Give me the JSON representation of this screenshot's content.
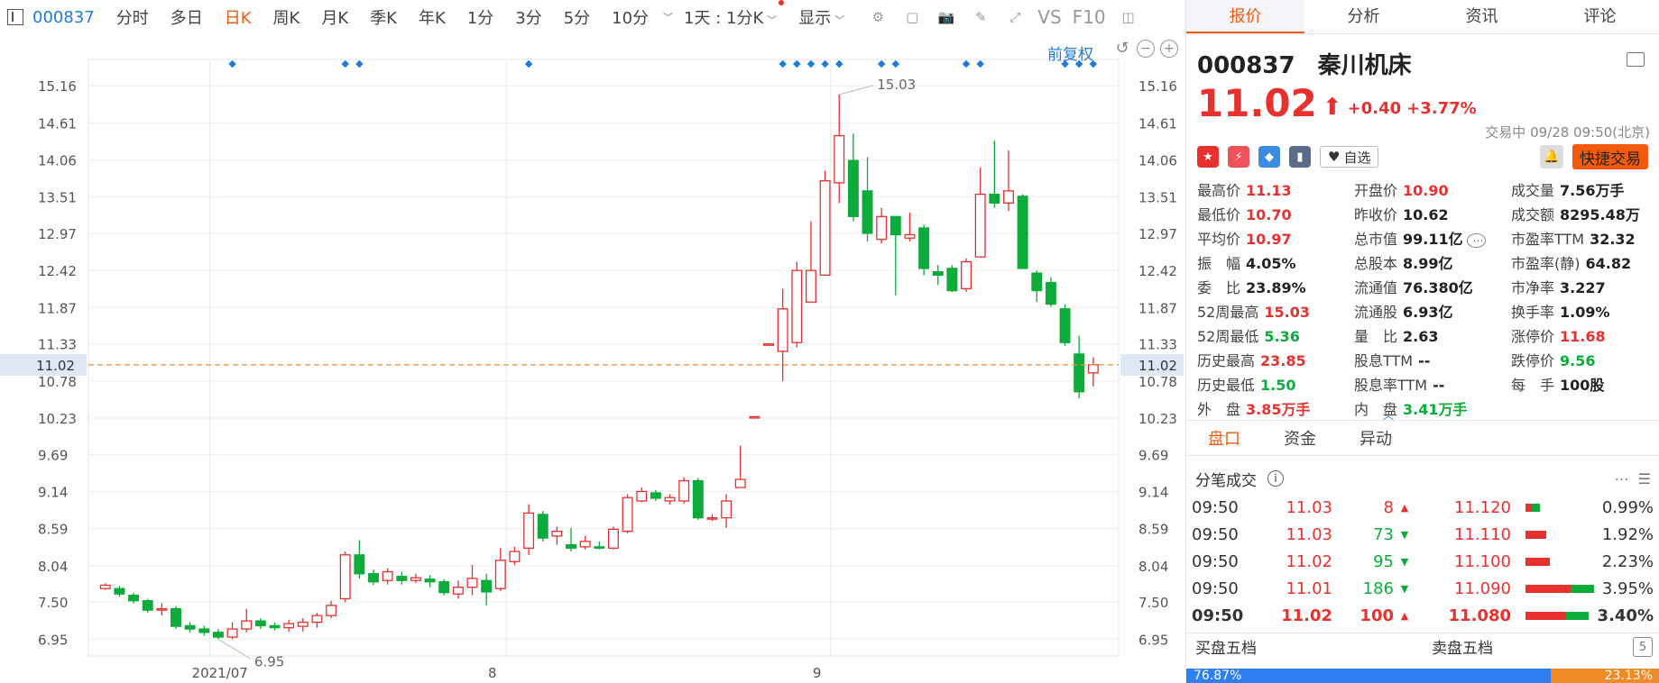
{
  "toolbar": {
    "code": "000837",
    "items": [
      "分时",
      "多日",
      "日K",
      "周K",
      "月K",
      "季K",
      "年K",
      "1分",
      "3分",
      "5分",
      "10分"
    ],
    "active": "日K",
    "period_select": "1天 : 1分K",
    "display": "显示",
    "f10": "F10",
    "vs": "VS"
  },
  "chart_controls": {
    "adjust": "前复权"
  },
  "chart_data": {
    "type": "candlestick",
    "x_labels": [
      "2021/07",
      "8",
      "9"
    ],
    "y_ticks": [
      15.16,
      14.61,
      14.06,
      13.51,
      12.97,
      12.42,
      11.87,
      11.33,
      10.78,
      10.23,
      9.69,
      9.14,
      8.59,
      8.04,
      7.5,
      6.95
    ],
    "ylim": [
      6.7,
      15.55
    ],
    "current_price": "11.02",
    "annotations": {
      "high": "15.03",
      "low": "6.95"
    },
    "candles": [
      [
        7.7,
        7.75,
        7.68,
        7.78
      ],
      [
        7.7,
        7.62,
        7.58,
        7.74
      ],
      [
        7.6,
        7.52,
        7.48,
        7.64
      ],
      [
        7.52,
        7.38,
        7.34,
        7.55
      ],
      [
        7.38,
        7.4,
        7.3,
        7.48
      ],
      [
        7.4,
        7.14,
        7.1,
        7.44
      ],
      [
        7.15,
        7.1,
        7.05,
        7.2
      ],
      [
        7.1,
        7.05,
        7.0,
        7.15
      ],
      [
        7.05,
        6.98,
        6.95,
        7.1
      ],
      [
        6.98,
        7.1,
        6.95,
        7.2
      ],
      [
        7.1,
        7.22,
        7.05,
        7.4
      ],
      [
        7.22,
        7.15,
        7.1,
        7.26
      ],
      [
        7.15,
        7.12,
        7.08,
        7.2
      ],
      [
        7.12,
        7.18,
        7.06,
        7.24
      ],
      [
        7.14,
        7.2,
        7.06,
        7.26
      ],
      [
        7.2,
        7.3,
        7.12,
        7.34
      ],
      [
        7.3,
        7.45,
        7.26,
        7.52
      ],
      [
        7.55,
        8.2,
        7.5,
        8.25
      ],
      [
        8.2,
        7.92,
        7.85,
        8.42
      ],
      [
        7.92,
        7.8,
        7.75,
        7.98
      ],
      [
        7.82,
        7.95,
        7.76,
        8.0
      ],
      [
        7.88,
        7.82,
        7.76,
        7.95
      ],
      [
        7.82,
        7.86,
        7.78,
        7.92
      ],
      [
        7.84,
        7.8,
        7.72,
        7.9
      ],
      [
        7.8,
        7.64,
        7.6,
        7.84
      ],
      [
        7.62,
        7.72,
        7.55,
        7.82
      ],
      [
        7.72,
        7.85,
        7.6,
        8.05
      ],
      [
        7.82,
        7.65,
        7.45,
        7.92
      ],
      [
        7.7,
        8.12,
        7.66,
        8.3
      ],
      [
        8.1,
        8.25,
        8.05,
        8.32
      ],
      [
        8.3,
        8.82,
        8.2,
        8.95
      ],
      [
        8.8,
        8.45,
        8.4,
        8.85
      ],
      [
        8.48,
        8.55,
        8.35,
        8.62
      ],
      [
        8.35,
        8.3,
        8.25,
        8.6
      ],
      [
        8.32,
        8.4,
        8.28,
        8.48
      ],
      [
        8.32,
        8.3,
        8.28,
        8.4
      ],
      [
        8.3,
        8.58,
        8.28,
        8.62
      ],
      [
        8.55,
        9.05,
        8.52,
        9.1
      ],
      [
        9.0,
        9.14,
        8.98,
        9.2
      ],
      [
        9.12,
        9.04,
        9.0,
        9.16
      ],
      [
        9.0,
        9.05,
        8.95,
        9.1
      ],
      [
        9.0,
        9.3,
        8.96,
        9.35
      ],
      [
        9.3,
        8.75,
        8.72,
        9.34
      ],
      [
        8.75,
        8.75,
        8.7,
        8.8
      ],
      [
        8.75,
        9.0,
        8.6,
        9.1
      ],
      [
        9.2,
        9.32,
        9.2,
        9.82
      ],
      [
        10.25,
        10.25,
        10.25,
        10.25
      ],
      [
        11.33,
        11.33,
        11.33,
        11.33
      ],
      [
        11.22,
        11.85,
        10.78,
        12.15
      ],
      [
        11.35,
        12.42,
        11.28,
        12.55
      ],
      [
        11.95,
        12.42,
        11.95,
        13.15
      ],
      [
        12.35,
        13.75,
        12.35,
        13.9
      ],
      [
        13.72,
        14.42,
        13.42,
        15.03
      ],
      [
        14.05,
        13.22,
        13.15,
        14.45
      ],
      [
        13.6,
        12.97,
        12.85,
        14.1
      ],
      [
        12.88,
        13.22,
        12.82,
        13.35
      ],
      [
        13.22,
        12.95,
        12.05,
        13.22
      ],
      [
        12.9,
        12.95,
        12.85,
        13.28
      ],
      [
        13.05,
        12.45,
        12.35,
        13.1
      ],
      [
        12.4,
        12.35,
        12.2,
        12.5
      ],
      [
        12.45,
        12.12,
        12.1,
        12.5
      ],
      [
        12.15,
        12.55,
        12.1,
        12.6
      ],
      [
        12.62,
        13.55,
        12.62,
        13.95
      ],
      [
        13.55,
        13.42,
        13.35,
        14.35
      ],
      [
        13.42,
        13.6,
        13.3,
        14.2
      ],
      [
        13.52,
        12.45,
        12.45,
        13.55
      ],
      [
        12.38,
        12.12,
        11.95,
        12.42
      ],
      [
        12.24,
        11.92,
        11.88,
        12.32
      ],
      [
        11.85,
        11.35,
        11.3,
        11.92
      ],
      [
        11.18,
        10.62,
        10.52,
        11.45
      ],
      [
        10.9,
        11.02,
        10.7,
        11.13
      ]
    ]
  },
  "panel": {
    "tabs": [
      "报价",
      "分析",
      "资讯",
      "评论"
    ],
    "active_tab": "报价",
    "code": "000837",
    "name": "秦川机床",
    "price": "11.02",
    "change": "+0.40",
    "change_pct": "+3.77%",
    "trade_time": "交易中 09/28 09:50(北京)",
    "watch": "自选",
    "quick_trade": "快捷交易",
    "quotes": [
      {
        "label": "最高价",
        "value": "11.13",
        "color": "red"
      },
      {
        "label": "开盘价",
        "value": "10.90",
        "color": "red"
      },
      {
        "label": "成交量",
        "value": "7.56万手",
        "color": "dark"
      },
      {
        "label": "最低价",
        "value": "10.70",
        "color": "red"
      },
      {
        "label": "昨收价",
        "value": "10.62",
        "color": "dark"
      },
      {
        "label": "成交额",
        "value": "8295.48万",
        "color": "dark"
      },
      {
        "label": "平均价",
        "value": "10.97",
        "color": "red"
      },
      {
        "label": "总市值",
        "value": "99.11亿",
        "color": "dark"
      },
      {
        "label": "市盈率TTM",
        "value": "32.32",
        "color": "dark"
      },
      {
        "label": "振　幅",
        "value": "4.05%",
        "color": "dark"
      },
      {
        "label": "总股本",
        "value": "8.99亿",
        "color": "dark"
      },
      {
        "label": "市盈率(静)",
        "value": "64.82",
        "color": "dark"
      },
      {
        "label": "委　比",
        "value": "23.89%",
        "color": "dark"
      },
      {
        "label": "流通值",
        "value": "76.380亿",
        "color": "dark"
      },
      {
        "label": "市净率",
        "value": "3.227",
        "color": "dark"
      },
      {
        "label": "52周最高",
        "value": "15.03",
        "color": "red"
      },
      {
        "label": "流通股",
        "value": "6.93亿",
        "color": "dark"
      },
      {
        "label": "换手率",
        "value": "1.09%",
        "color": "dark"
      },
      {
        "label": "52周最低",
        "value": "5.36",
        "color": "green"
      },
      {
        "label": "量　比",
        "value": "2.63",
        "color": "dark"
      },
      {
        "label": "涨停价",
        "value": "11.68",
        "color": "red"
      },
      {
        "label": "历史最高",
        "value": "23.85",
        "color": "red"
      },
      {
        "label": "股息TTM",
        "value": "--",
        "color": "dark"
      },
      {
        "label": "跌停价",
        "value": "9.56",
        "color": "green"
      },
      {
        "label": "历史最低",
        "value": "1.50",
        "color": "green"
      },
      {
        "label": "股息率TTM",
        "value": "--",
        "color": "dark"
      },
      {
        "label": "每　手",
        "value": "100股",
        "color": "dark"
      },
      {
        "label": "外　盘",
        "value": "3.85万手",
        "color": "red"
      },
      {
        "label": "内　盘",
        "value": "3.41万手",
        "color": "green"
      },
      {
        "label": "",
        "value": "",
        "color": "dark"
      }
    ],
    "sub_tabs": [
      "盘口",
      "资金",
      "异动"
    ],
    "ticks_title": "分笔成交",
    "ticks": [
      {
        "time": "09:50",
        "price": "11.03",
        "vol": "8",
        "dir": "up",
        "lp": "11.120",
        "buy": 0.12,
        "sell": 0.1,
        "pct": "0.99%"
      },
      {
        "time": "09:50",
        "price": "11.03",
        "vol": "73",
        "dir": "down",
        "lp": "11.110",
        "buy": 0.0,
        "sell": 0.32,
        "pct": "1.92%"
      },
      {
        "time": "09:50",
        "price": "11.02",
        "vol": "95",
        "dir": "down",
        "lp": "11.100",
        "buy": 0.0,
        "sell": 0.38,
        "pct": "2.23%"
      },
      {
        "time": "09:50",
        "price": "11.01",
        "vol": "186",
        "dir": "down",
        "lp": "11.090",
        "buy": 0.35,
        "sell": 0.7,
        "pct": "3.95%"
      },
      {
        "time": "09:50",
        "price": "11.02",
        "vol": "100",
        "dir": "up",
        "lp": "11.080",
        "buy": 0.35,
        "sell": 0.62,
        "pct": "3.40%"
      }
    ],
    "depth": {
      "buy_title": "买盘五档",
      "sell_title": "卖盘五档",
      "buy_ratio": "76.87%",
      "sell_ratio": "23.13%",
      "buy_fraction": 0.7687
    }
  }
}
